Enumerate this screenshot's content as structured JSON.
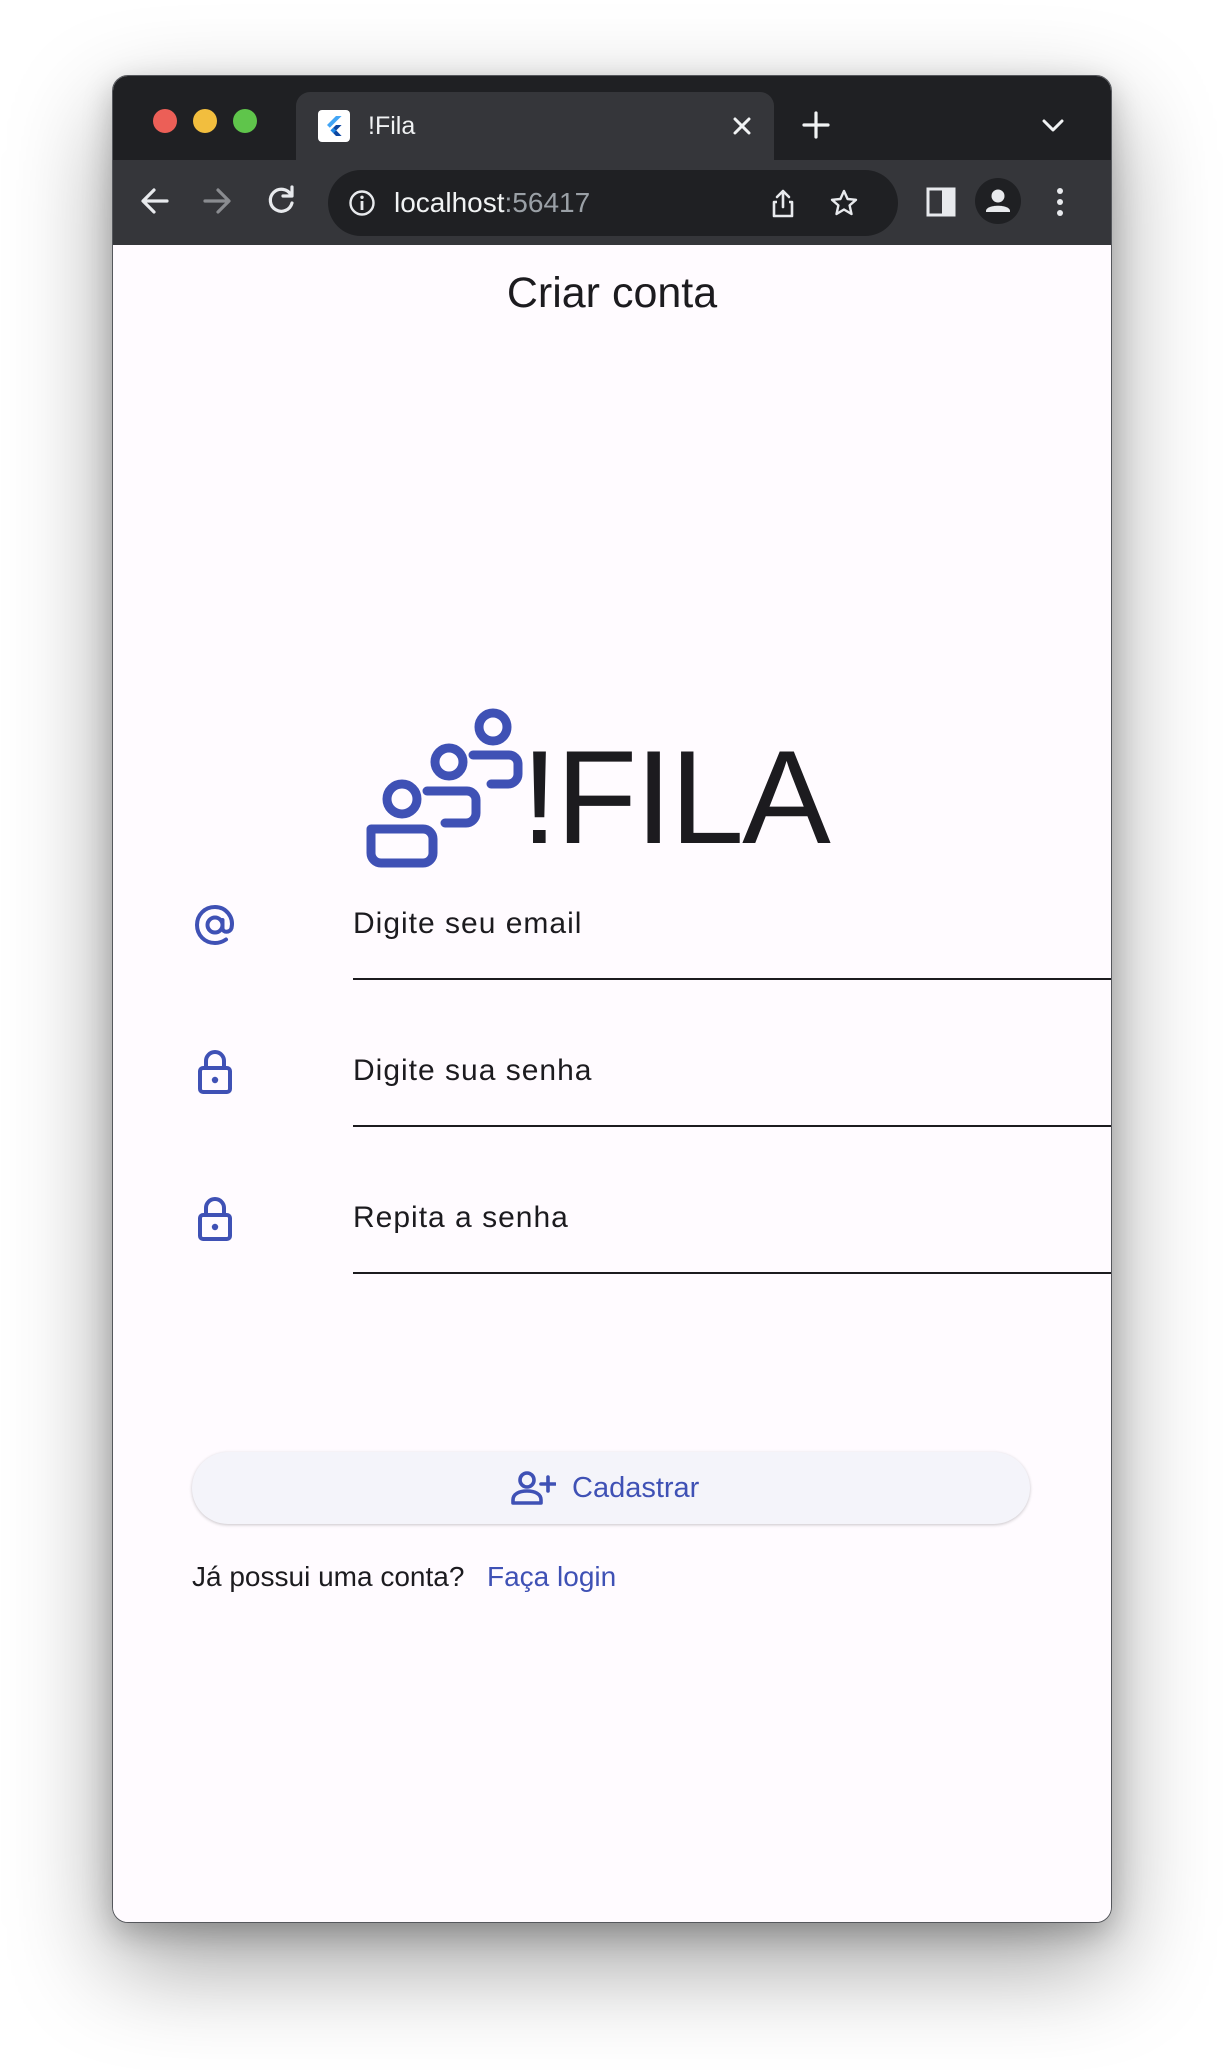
{
  "browser": {
    "tab": {
      "title": "!Fila"
    },
    "url": {
      "host": "localhost",
      "port": ":56417"
    }
  },
  "page": {
    "title": "Criar conta",
    "logo": {
      "text": "!FILA",
      "color": "#3f51b5"
    },
    "form": {
      "email_placeholder": "Digite seu email",
      "password_placeholder": "Digite sua senha",
      "repeat_placeholder": "Repita a senha"
    },
    "register_button": {
      "label": "Cadastrar"
    },
    "login_prompt": {
      "text": "Já possui uma conta?",
      "link": "Faça login"
    }
  },
  "colors": {
    "primary": "#3f51b5",
    "chrome_dark": "#1f2023",
    "chrome_tab": "#35363a"
  }
}
